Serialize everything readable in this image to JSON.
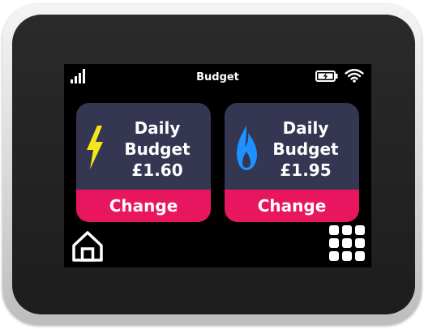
{
  "status_bar": {
    "title": "Budget",
    "icons": [
      "signal-icon",
      "battery-charging-icon",
      "wifi-icon"
    ]
  },
  "cards": [
    {
      "fuel": "electricity",
      "icon": "lightning-bolt-icon",
      "icon_color": "#f5e61c",
      "line1": "Daily",
      "line2": "Budget",
      "amount": "£1.60",
      "button_label": "Change"
    },
    {
      "fuel": "gas",
      "icon": "flame-icon",
      "icon_color": "#1e90ff",
      "line1": "Daily",
      "line2": "Budget",
      "amount": "£1.95",
      "button_label": "Change"
    }
  ],
  "navigation": {
    "home_icon": "home-icon",
    "menu_icon": "grid-menu-icon"
  },
  "colors": {
    "card_background": "#343652",
    "accent": "#e8165f",
    "screen_background": "#000000",
    "text": "#ffffff"
  }
}
